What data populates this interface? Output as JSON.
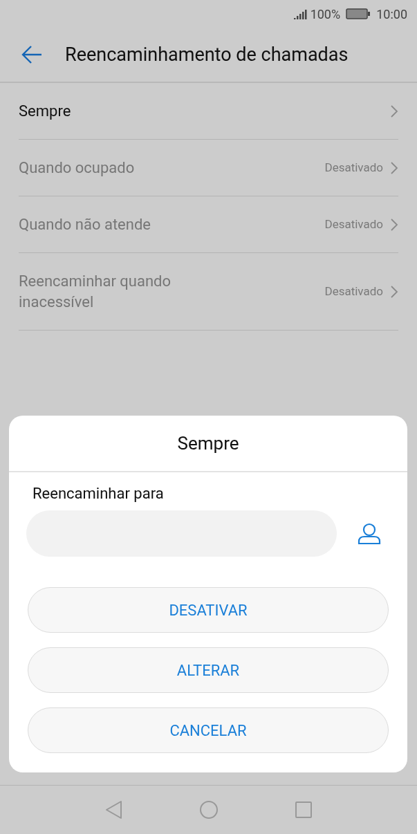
{
  "status_bar": {
    "battery": "100%",
    "time": "10:00"
  },
  "header": {
    "title": "Reencaminhamento de chamadas"
  },
  "items": [
    {
      "label": "Sempre",
      "disabled": false
    },
    {
      "label": "Quando ocupado",
      "status": "Desativado",
      "disabled": true
    },
    {
      "label": "Quando não atende",
      "status": "Desativado",
      "disabled": true
    },
    {
      "label": "Reencaminhar quando inacessível",
      "status": "Desativado",
      "disabled": true
    }
  ],
  "dialog": {
    "title": "Sempre",
    "field_label": "Reencaminhar para",
    "buttons": [
      "DESATIVAR",
      "ALTERAR",
      "CANCELAR"
    ]
  }
}
